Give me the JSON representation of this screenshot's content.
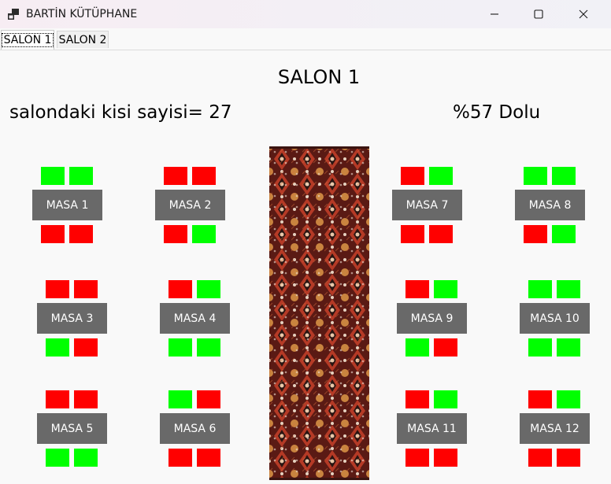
{
  "window": {
    "title": "BARTİN KÜTÜPHANE",
    "icon": "app-window-icon",
    "controls": [
      "minimize-icon",
      "maximize-icon",
      "close-icon"
    ]
  },
  "tabs": [
    {
      "label": "SALON 1",
      "selected": true
    },
    {
      "label": "SALON 2",
      "selected": false
    }
  ],
  "salon": {
    "title": "SALON 1",
    "count_text": "salondaki kisi sayisi= 27",
    "percent_text": "%57 Dolu"
  },
  "colors": {
    "occupied": "#ff0000",
    "free": "#00ff00",
    "table": "#696969"
  },
  "tables": [
    {
      "label": "MASA 1",
      "top": [
        "green",
        "green"
      ],
      "bottom": [
        "red",
        "red"
      ]
    },
    {
      "label": "MASA 2",
      "top": [
        "red",
        "red"
      ],
      "bottom": [
        "red",
        "green"
      ]
    },
    {
      "label": "MASA 3",
      "top": [
        "red",
        "red"
      ],
      "bottom": [
        "green",
        "red"
      ]
    },
    {
      "label": "MASA 4",
      "top": [
        "red",
        "green"
      ],
      "bottom": [
        "green",
        "green"
      ]
    },
    {
      "label": "MASA 5",
      "top": [
        "red",
        "red"
      ],
      "bottom": [
        "green",
        "green"
      ]
    },
    {
      "label": "MASA 6",
      "top": [
        "green",
        "red"
      ],
      "bottom": [
        "red",
        "red"
      ]
    },
    {
      "label": "MASA 7",
      "top": [
        "red",
        "green"
      ],
      "bottom": [
        "red",
        "red"
      ]
    },
    {
      "label": "MASA 8",
      "top": [
        "green",
        "green"
      ],
      "bottom": [
        "red",
        "green"
      ]
    },
    {
      "label": "MASA 9",
      "top": [
        "red",
        "green"
      ],
      "bottom": [
        "green",
        "red"
      ]
    },
    {
      "label": "MASA 10",
      "top": [
        "green",
        "green"
      ],
      "bottom": [
        "green",
        "green"
      ]
    },
    {
      "label": "MASA 11",
      "top": [
        "red",
        "green"
      ],
      "bottom": [
        "red",
        "red"
      ]
    },
    {
      "label": "MASA 12",
      "top": [
        "red",
        "green"
      ],
      "bottom": [
        "red",
        "red"
      ]
    }
  ]
}
